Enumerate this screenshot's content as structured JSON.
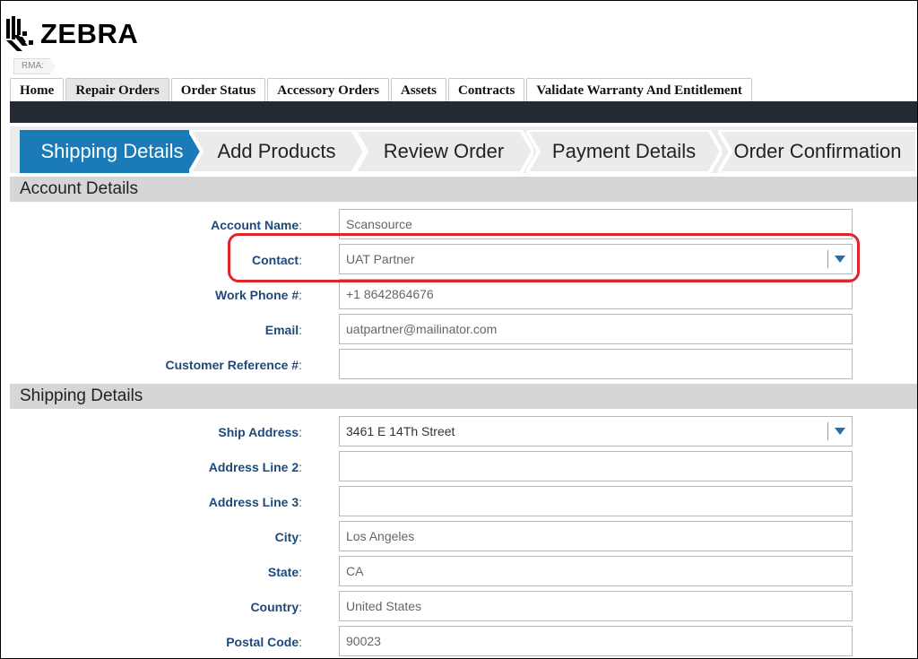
{
  "brand": {
    "logo_text": "ZEBRA"
  },
  "breadcrumb": "RMA:",
  "tabs": [
    {
      "label": "Home"
    },
    {
      "label": "Repair Orders"
    },
    {
      "label": "Order Status"
    },
    {
      "label": "Accessory Orders"
    },
    {
      "label": "Assets"
    },
    {
      "label": "Contracts"
    },
    {
      "label": "Validate Warranty And Entitlement"
    }
  ],
  "steps": [
    {
      "label": "Shipping Details",
      "active": true
    },
    {
      "label": "Add Products"
    },
    {
      "label": "Review Order"
    },
    {
      "label": "Payment Details"
    },
    {
      "label": "Order Confirmation"
    }
  ],
  "account_section": {
    "title": "Account Details",
    "account_name": {
      "label": "Account Name",
      "value": "Scansource"
    },
    "contact": {
      "label": "Contact",
      "value": "UAT Partner"
    },
    "work_phone": {
      "label": "Work Phone #",
      "value": "+1 8642864676"
    },
    "email": {
      "label": "Email",
      "value": "uatpartner@mailinator.com"
    },
    "customer_reference": {
      "label": "Customer Reference #",
      "value": ""
    }
  },
  "shipping_section": {
    "title": "Shipping Details",
    "ship_address": {
      "label": "Ship Address",
      "value": "3461 E 14Th Street"
    },
    "address_line_2": {
      "label": "Address Line 2",
      "value": ""
    },
    "address_line_3": {
      "label": "Address Line 3",
      "value": ""
    },
    "city": {
      "label": "City",
      "value": "Los Angeles"
    },
    "state": {
      "label": "State",
      "value": "CA"
    },
    "country": {
      "label": "Country",
      "value": "United States"
    },
    "postal_code": {
      "label": "Postal Code",
      "value": "90023"
    }
  },
  "colors": {
    "active_step": "#1b7ab8",
    "label_blue": "#1d4a7a",
    "nav_bar": "#232a34",
    "highlight": "#e0242a"
  },
  "icons": [
    "zebra-logo-icon",
    "chevron-down-icon"
  ]
}
